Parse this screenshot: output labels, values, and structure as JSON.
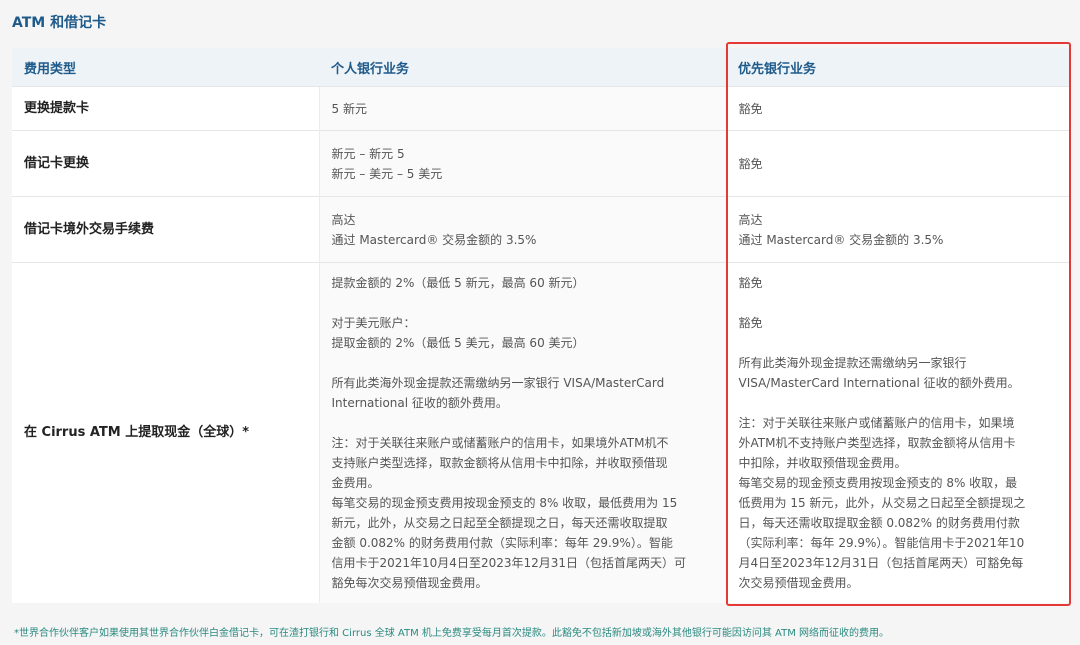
{
  "section_title": "ATM 和借记卡",
  "headers": [
    "费用类型",
    "个人银行业务",
    "优先银行业务"
  ],
  "rows": [
    {
      "type": "更换提款卡",
      "personal": [
        "5 新元"
      ],
      "priority": [
        "豁免"
      ]
    },
    {
      "type": "借记卡更换",
      "personal": [
        "新元 – 新元 5",
        "新元 – 美元 – 5 美元"
      ],
      "priority": [
        "豁免"
      ]
    },
    {
      "type": "借记卡境外交易手续费",
      "personal": [
        "高达",
        "通过 Mastercard® 交易金额的 3.5%"
      ],
      "priority": [
        "高达",
        "通过 Mastercard® 交易金额的 3.5%"
      ]
    },
    {
      "type": "在 Cirrus ATM 上提取现金（全球）*",
      "personal": [
        "提款金额的 2%（最低 5 新元，最高 60 新元）",
        "",
        "对于美元账户：",
        "提取金额的 2%（最低 5 美元，最高 60 美元）",
        "",
        "所有此类海外现金提款还需缴纳另一家银行 VISA/MasterCard",
        "International 征收的额外费用。",
        "",
        "注：对于关联往来账户或储蓄账户的信用卡，如果境外ATM机不",
        "支持账户类型选择，取款金额将从信用卡中扣除，并收取预借现",
        "金费用。",
        "每笔交易的现金预支费用按现金预支的 8% 收取，最低费用为 15",
        "新元，此外，从交易之日起至全额提现之日，每天还需收取提取",
        "金额 0.082% 的财务费用付款（实际利率：每年 29.9%）。智能",
        "信用卡于2021年10月4日至2023年12月31日（包括首尾两天）可",
        "豁免每次交易预借现金费用。"
      ],
      "priority": [
        "豁免",
        "",
        "豁免",
        "",
        "所有此类海外现金提款还需缴纳另一家银行",
        "VISA/MasterCard International 征收的额外费用。",
        "",
        "注：对于关联往来账户或储蓄账户的信用卡，如果境",
        "外ATM机不支持账户类型选择，取款金额将从信用卡",
        "中扣除，并收取预借现金费用。",
        "每笔交易的现金预支费用按现金预支的 8% 收取，最",
        "低费用为 15 新元，此外，从交易之日起至全额提现之",
        "日，每天还需收取提取金额 0.082% 的财务费用付款",
        "（实际利率：每年 29.9%）。智能信用卡于2021年10",
        "月4日至2023年12月31日（包括首尾两天）可豁免每",
        "次交易预借现金费用。"
      ]
    }
  ],
  "footnote": "*世界合作伙伴客户如果使用其世界合作伙伴白金借记卡，可在渣打银行和 Cirrus 全球 ATM 机上免费享受每月首次提款。此豁免不包括新加坡或海外其他银行可能因访问其 ATM 网络而征收的费用。",
  "colors": {
    "accent": "#1e5a8a",
    "highlight": "#e53935",
    "footnote": "#2a8a80"
  }
}
